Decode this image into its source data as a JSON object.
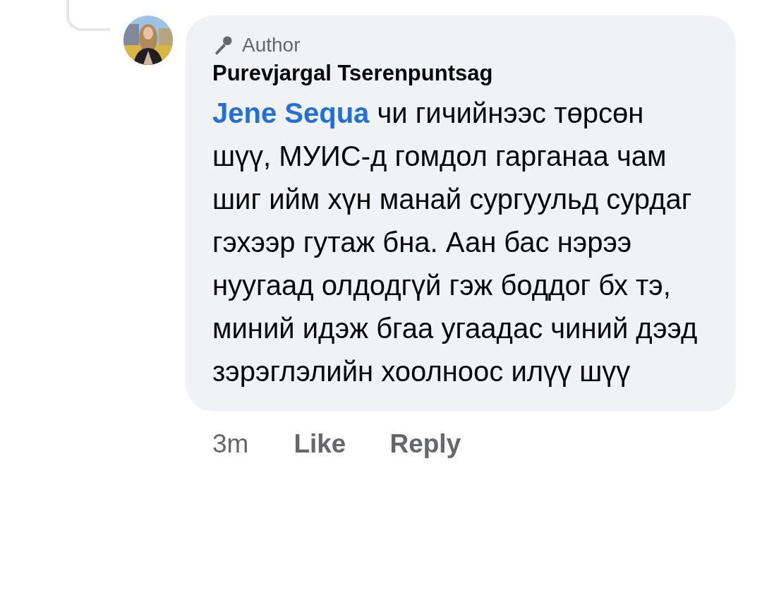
{
  "comment": {
    "badge": "Author",
    "author": "Purevjargal Tserenpuntsag",
    "mention": "Jene Sequa",
    "text": "чи гичийнээс төрсөн шүү, МУИС-д гомдол гарганаа чам шиг ийм хүн манай сургуульд сурдаг гэхээр гутаж бна. Аан бас нэрээ нуугаад олдодгүй гэж боддог бх тэ, миний идэж бгаа угаадас чиний дээд зэрэглэлийн хоолноос илүү шүү",
    "time": "3m",
    "actions": [
      "Like",
      "Reply"
    ]
  }
}
